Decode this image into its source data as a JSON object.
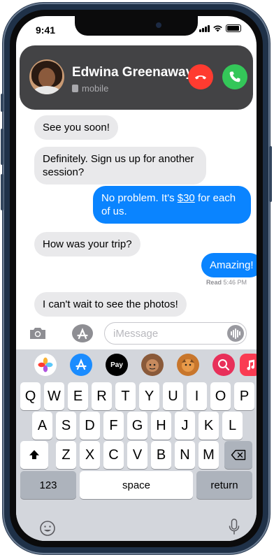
{
  "status_bar": {
    "time": "9:41"
  },
  "call": {
    "caller_name": "Edwina Greenaway",
    "caller_subtitle": "mobile"
  },
  "messages": [
    {
      "from": "them",
      "text": "See you soon!"
    },
    {
      "from": "them",
      "text": "Definitely. Sign us up for another session?"
    },
    {
      "from": "me",
      "text_before": "No problem. It's ",
      "text_link": "$30",
      "text_after": " for each of us."
    },
    {
      "from": "them",
      "text": "How was your trip?"
    },
    {
      "from": "me",
      "text": "Amazing!"
    },
    {
      "from": "them",
      "text": "I can't wait to see the photos!"
    }
  ],
  "read_receipt": {
    "label": "Read",
    "time": "5:46 PM"
  },
  "input": {
    "placeholder": "iMessage"
  },
  "app_drawer": [
    {
      "name": "photos",
      "color": "#ffffff"
    },
    {
      "name": "app-store",
      "color": "#1a8cff"
    },
    {
      "name": "apple-pay",
      "label": "Pay",
      "color": "#000000"
    },
    {
      "name": "memoji-1",
      "color": "#8a5a3a"
    },
    {
      "name": "memoji-2",
      "color": "#c8762c"
    },
    {
      "name": "search-images",
      "color": "#e8305a"
    },
    {
      "name": "music",
      "color": "#fa3b52"
    }
  ],
  "keyboard": {
    "row1": [
      "Q",
      "W",
      "E",
      "R",
      "T",
      "Y",
      "U",
      "I",
      "O",
      "P"
    ],
    "row2": [
      "A",
      "S",
      "D",
      "F",
      "G",
      "H",
      "J",
      "K",
      "L"
    ],
    "row3": [
      "Z",
      "X",
      "C",
      "V",
      "B",
      "N",
      "M"
    ],
    "numbers_label": "123",
    "space_label": "space",
    "return_label": "return"
  },
  "colors": {
    "outgoing_bubble": "#0a84ff",
    "incoming_bubble": "#e9e9eb",
    "decline": "#ff3b30",
    "accept": "#34c759",
    "banner": "#434345"
  }
}
